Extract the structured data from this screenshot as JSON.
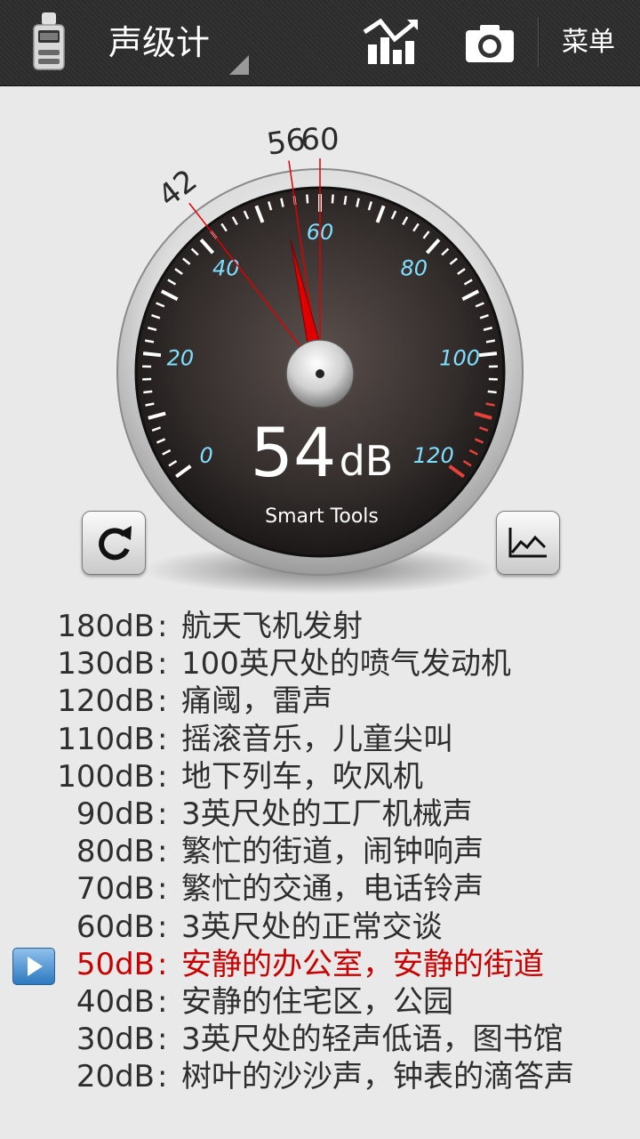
{
  "header": {
    "title": "声级计",
    "menu_label": "菜单",
    "icons": [
      "sound-meter-app-icon",
      "chart-stats-icon",
      "camera-icon"
    ]
  },
  "gauge": {
    "min": 0,
    "max": 120,
    "value": 54,
    "reading_value": "54",
    "reading_unit": "dB",
    "brand": "Smart Tools",
    "scale_labels": [
      "0",
      "20",
      "40",
      "60",
      "80",
      "100",
      "120"
    ],
    "markers": [
      {
        "label": "42",
        "value": 42
      },
      {
        "label": "56",
        "value": 56
      },
      {
        "label": "60",
        "value": 60
      }
    ],
    "accent_colors": {
      "needle": "#e00000",
      "scale_label": "#7fdfff",
      "danger_ticks": "#e8413a"
    }
  },
  "buttons": {
    "reset_icon": "refresh-icon",
    "graph_icon": "line-graph-icon"
  },
  "levels": [
    {
      "db": "180dB",
      "sep": ":",
      "desc": "航天飞机发射"
    },
    {
      "db": "130dB",
      "sep": ":",
      "desc": "100英尺处的喷气发动机"
    },
    {
      "db": "120dB",
      "sep": ":",
      "desc": "痛阈，雷声"
    },
    {
      "db": "110dB",
      "sep": ":",
      "desc": "摇滚音乐，儿童尖叫"
    },
    {
      "db": "100dB",
      "sep": ":",
      "desc": "地下列车，吹风机"
    },
    {
      "db": "90dB",
      "sep": ":",
      "desc": "3英尺处的工厂机械声"
    },
    {
      "db": "80dB",
      "sep": ":",
      "desc": "繁忙的街道，闹钟响声"
    },
    {
      "db": "70dB",
      "sep": ":",
      "desc": "繁忙的交通，电话铃声"
    },
    {
      "db": "60dB",
      "sep": ":",
      "desc": "3英尺处的正常交谈"
    },
    {
      "db": "50dB",
      "sep": ":",
      "desc": "安静的办公室，安静的街道"
    },
    {
      "db": "40dB",
      "sep": ":",
      "desc": "安静的住宅区，公园"
    },
    {
      "db": "30dB",
      "sep": ":",
      "desc": "3英尺处的轻声低语，图书馆"
    },
    {
      "db": "20dB",
      "sep": ":",
      "desc": "树叶的沙沙声，钟表的滴答声"
    }
  ],
  "current_level": 9
}
